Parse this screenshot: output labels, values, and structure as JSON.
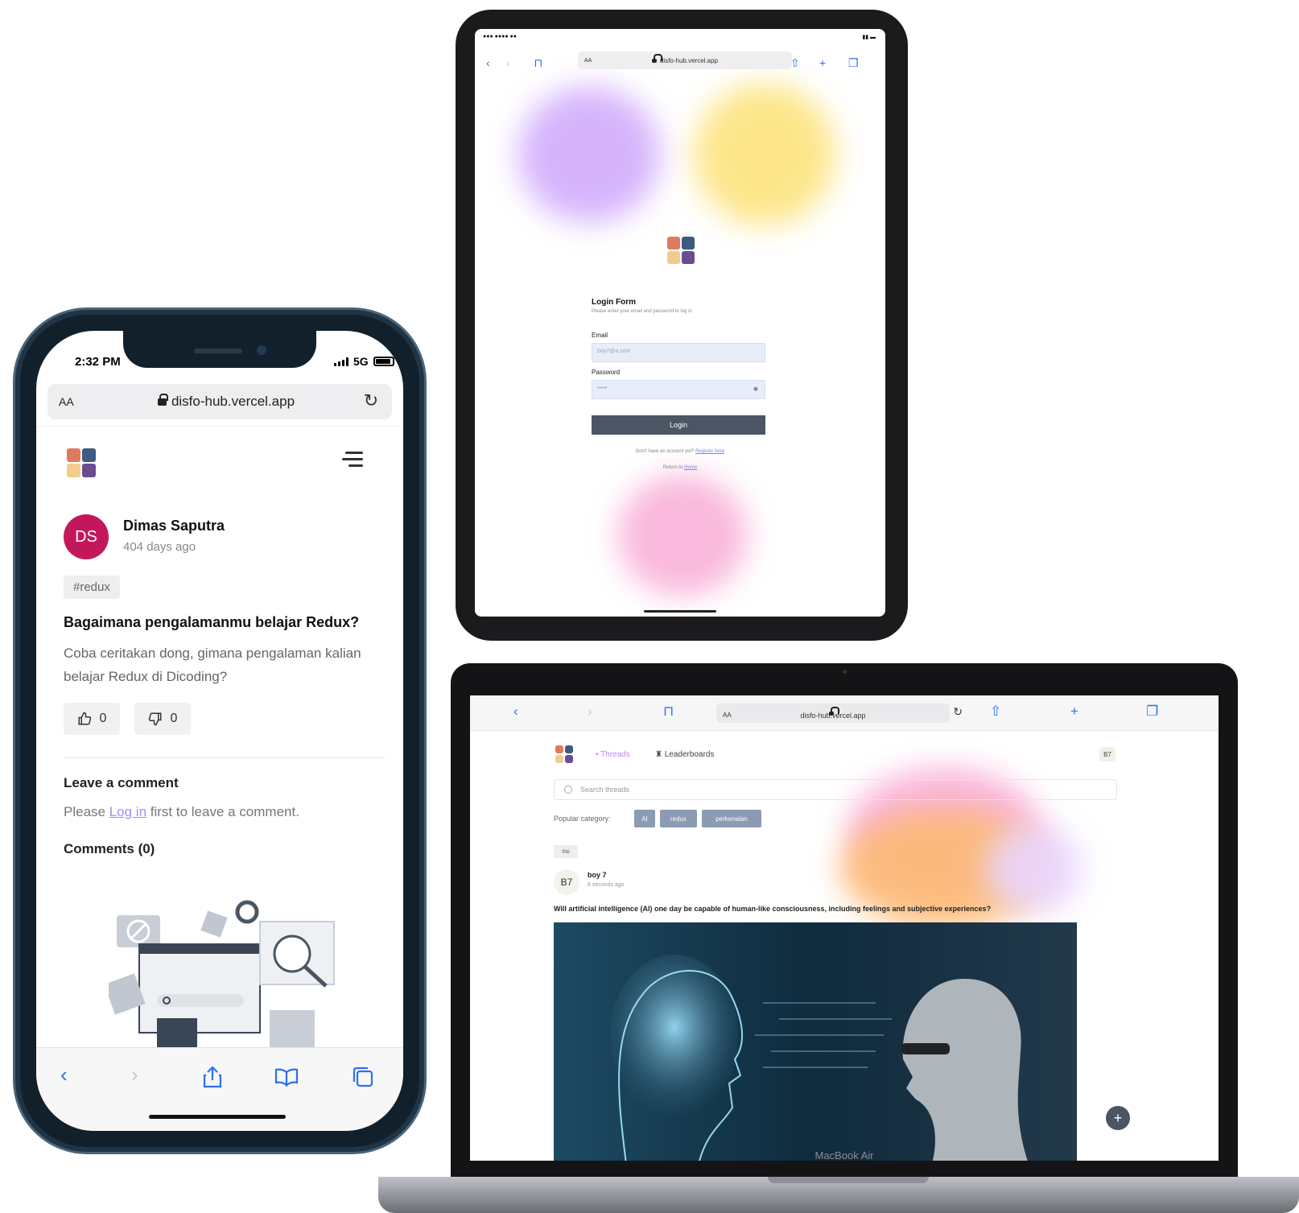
{
  "phone": {
    "status": {
      "time": "2:32 PM",
      "network": "5G"
    },
    "browser": {
      "aa": "AA",
      "url": "disfo-hub.vercel.app"
    },
    "post": {
      "author": "Dimas Saputra",
      "initials": "DS",
      "time_ago": "404 days ago",
      "tag": "#redux",
      "title": "Bagaimana pengalamanmu belajar Redux?",
      "body": "Coba ceritakan dong, gimana pengalaman kalian belajar Redux di Dicoding?",
      "upvotes": "0",
      "downvotes": "0"
    },
    "comment": {
      "heading": "Leave a comment",
      "please_prefix": "Please ",
      "login_link": "Log in",
      "please_suffix": " first to leave a comment.",
      "comments_heading": "Comments (0)"
    },
    "icons": {
      "back": "back-icon",
      "forward": "forward-icon",
      "share": "share-icon",
      "bookmarks": "bookmarks-icon",
      "tabs": "tabs-icon"
    },
    "colors": {
      "avatar": "#c2185b",
      "link": "#a78bfa",
      "toolbar_icons": "#2f6fea"
    }
  },
  "tablet": {
    "browser": {
      "aa": "AA",
      "url": "disfo-hub.vercel.app"
    },
    "login": {
      "heading": "Login Form",
      "subheading": "Please enter your email and password to log in",
      "email_label": "Email",
      "email_value": "boy7@a.com",
      "password_label": "Password",
      "password_value": "•••••",
      "button": "Login",
      "signup_prefix": "Don't have an account yet? ",
      "signup_link": "Register here",
      "return_prefix": "Return to ",
      "return_link": "Home"
    },
    "colors": {
      "button": "#4b5563",
      "input": "#e8eef9",
      "blob_purple": "#d6b4fc",
      "blob_yellow": "#fde68a",
      "blob_pink": "#f9b8dc"
    }
  },
  "laptop": {
    "label": "MacBook Air",
    "browser": {
      "aa": "AA",
      "url": "disfo-hub.vercel.app"
    },
    "nav": {
      "threads": "Threads",
      "leaderboards": "Leaderboards",
      "user_badge": "B7"
    },
    "search": {
      "placeholder": "Search threads"
    },
    "popular": {
      "label": "Popular category:",
      "categories": [
        "AI",
        "redux",
        "perkenalan"
      ]
    },
    "thread": {
      "category": "#ai",
      "avatar": "B7",
      "author": "boy 7",
      "time_ago": "8 seconds ago",
      "title": "Will artificial intelligence (AI) one day be capable of human-like consciousness, including feelings and subjective experiences?"
    },
    "fab": "+",
    "colors": {
      "chip": "#8a9bb3",
      "threads_link": "#c084fc",
      "fab": "#4b5563"
    }
  }
}
